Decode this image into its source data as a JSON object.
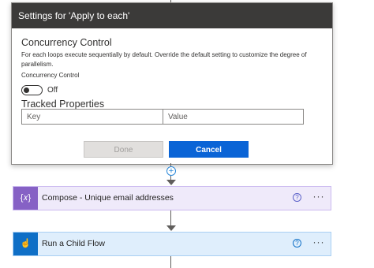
{
  "dialog": {
    "title": "Settings for 'Apply to each'",
    "concurrency_heading": "Concurrency Control",
    "concurrency_description": "For each loops execute sequentially by default. Override the default setting to customize the degree of parallelism.",
    "concurrency_toggle_label": "Concurrency Control",
    "toggle_state": "Off",
    "tracked_heading": "Tracked Properties",
    "key_placeholder": "Key",
    "value_placeholder": "Value",
    "done_label": "Done",
    "cancel_label": "Cancel"
  },
  "flow": {
    "add_step_symbol": "+",
    "actions": [
      {
        "title": "Compose - Unique email addresses",
        "icon": "compose-icon",
        "icon_glyph": "{𝑥}",
        "color": "#8661c5"
      },
      {
        "title": "Run a Child Flow",
        "icon": "child-flow-icon",
        "icon_glyph": "☝",
        "color": "#0f6fc6"
      }
    ],
    "help_symbol": "?",
    "more_symbol": "···"
  }
}
